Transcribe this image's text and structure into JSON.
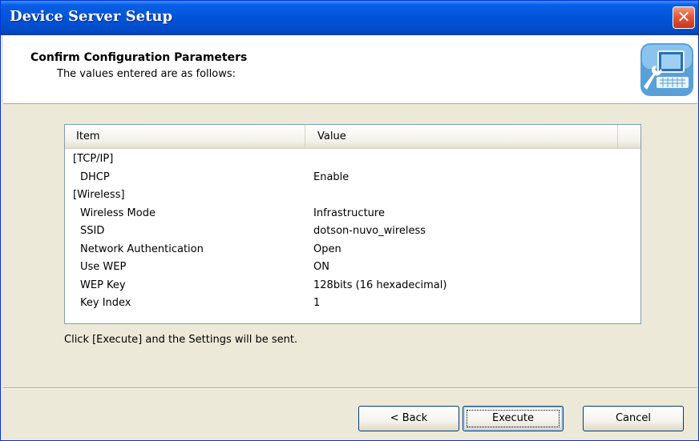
{
  "window": {
    "title": "Device Server Setup",
    "close_label": "✕"
  },
  "header": {
    "title": "Confirm Configuration Parameters",
    "subtitle": "The values entered are as follows:",
    "icon": "setup-computer-wrench-icon"
  },
  "table": {
    "columns": [
      "Item",
      "Value"
    ],
    "rows": [
      {
        "item": "[TCP/IP]",
        "value": "",
        "indent": false
      },
      {
        "item": "DHCP",
        "value": "Enable",
        "indent": true
      },
      {
        "item": "[Wireless]",
        "value": "",
        "indent": false
      },
      {
        "item": "Wireless Mode",
        "value": "Infrastructure",
        "indent": true
      },
      {
        "item": "SSID",
        "value": "dotson-nuvo_wireless",
        "indent": true
      },
      {
        "item": "Network Authentication",
        "value": "Open",
        "indent": true
      },
      {
        "item": "Use WEP",
        "value": "ON",
        "indent": true
      },
      {
        "item": "WEP Key",
        "value": "128bits (16 hexadecimal)",
        "indent": true
      },
      {
        "item": "Key Index",
        "value": "1",
        "indent": true
      }
    ]
  },
  "instruction": "Click [Execute] and the Settings will be sent.",
  "buttons": {
    "back": "< Back",
    "execute": "Execute",
    "cancel": "Cancel"
  }
}
